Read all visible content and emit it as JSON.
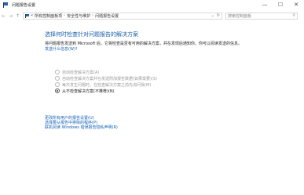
{
  "window": {
    "title": "问题报告设置",
    "controls": {
      "minimize": "—",
      "maximize": "☐",
      "close": "✕"
    }
  },
  "address": {
    "back": "←",
    "forward": "→",
    "up": "↑",
    "breadcrumbs": [
      "«",
      "所有控制面板项",
      "安全性与维护",
      "问题报告设置"
    ],
    "separator": "›",
    "dropdown": "⌄",
    "refresh": "↻",
    "search_placeholder": "搜索控制面板"
  },
  "main": {
    "heading": "选择何时检查针对问题报告的解决方案",
    "description": "将问题报告发送到 Microsoft 后，它将检查是否有可用的解决方案，并在发现后通知你。你可以阅读发送的信息。",
    "privacy_link": "发送什么信息(W)?",
    "options": [
      {
        "label": "自动检查解决方案(A)"
      },
      {
        "label": "自动检查解决方案并在发送附加报告数据(如果需要)(S)"
      },
      {
        "label": "每次发生问题时，在检查解决方案之前先询问我(M)"
      },
      {
        "label": "从不检查解决方案(不推荐)(N)"
      }
    ],
    "links": [
      "更改所有用户的报告设置(U)",
      "选择要从报告中排除的程序(P)",
      "联机阅读 Windows 错误报告隐私声明(R)"
    ]
  }
}
